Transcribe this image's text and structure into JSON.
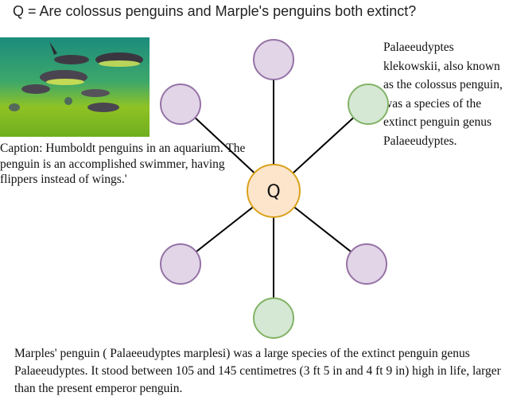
{
  "question": "Q = Are colossus penguins and Marple's penguins both extinct?",
  "image": {
    "subject": "Humboldt penguins swimming underwater in green aquarium water",
    "icon": "penguin-photo"
  },
  "caption": "Caption: Humboldt penguins in an aquarium. The penguin is an accomplished swimmer, having flippers instead of wings.'",
  "right_text": "Palaeeudyptes klekowskii, also known as the colossus penguin, was a species of the extinct penguin genus Palaeeudyptes.",
  "bottom_text": "Marples' penguin ( Palaeeudyptes marplesi) was a large species of the extinct penguin genus Palaeeudyptes. It stood between 105 and 145 centimetres (3 ft 5 in and 4 ft 9 in) high in life, larger than the present emperor penguin.",
  "graph": {
    "center": {
      "label": "Q",
      "fill": "#fde5cc",
      "stroke": "#d9a21b"
    },
    "colors": {
      "purple_fill": "#e1d5e7",
      "purple_stroke": "#9673a6",
      "green_fill": "#d5e8d4",
      "green_stroke": "#82b366",
      "edge": "#000000"
    },
    "nodes": [
      {
        "name": "node-top",
        "color": "purple"
      },
      {
        "name": "node-upper-right",
        "color": "green"
      },
      {
        "name": "node-lower-right",
        "color": "purple"
      },
      {
        "name": "node-bottom",
        "color": "green"
      },
      {
        "name": "node-lower-left",
        "color": "purple"
      },
      {
        "name": "node-upper-left",
        "color": "purple"
      }
    ]
  }
}
